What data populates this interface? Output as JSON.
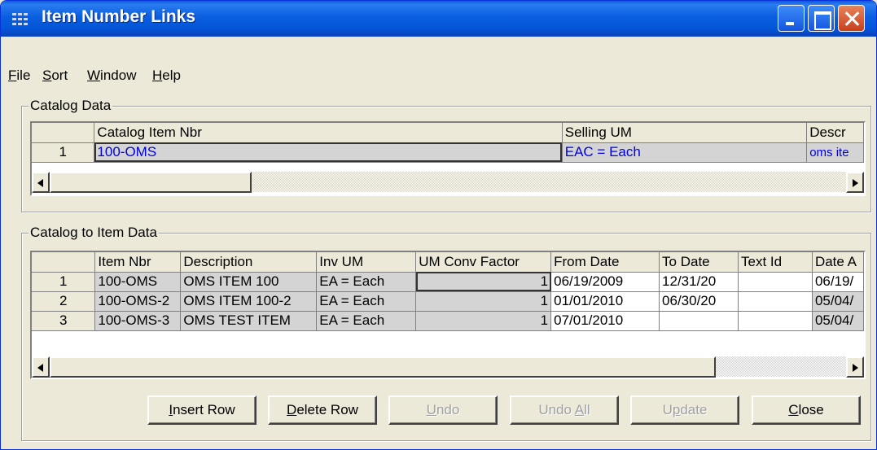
{
  "window": {
    "title": "Item Number Links"
  },
  "menu": [
    {
      "label": "File",
      "accel": "F",
      "rest": "ile"
    },
    {
      "label": "Sort",
      "accel": "S",
      "rest": "ort"
    },
    {
      "label": "Window",
      "accel": "W",
      "rest": "indow"
    },
    {
      "label": "Help",
      "accel": "H",
      "rest": "elp"
    }
  ],
  "catalog": {
    "group_label": "Catalog Data",
    "columns": [
      "Catalog Item Nbr",
      "Selling UM",
      "Descr"
    ],
    "rows": [
      {
        "num": "1",
        "item": "100-OMS",
        "um": "EAC = Each",
        "desc": "oms ite"
      }
    ]
  },
  "item_data": {
    "group_label": "Catalog to Item Data",
    "columns": [
      "Item Nbr",
      "Description",
      "Inv UM",
      "UM Conv Factor",
      "From Date",
      "To Date",
      "Text Id",
      "Date A"
    ],
    "rows": [
      {
        "num": "1",
        "item": "100-OMS",
        "desc": "OMS ITEM 100",
        "um": "EA = Each",
        "factor": "1",
        "from": "06/19/2009",
        "to": "12/31/20",
        "text": "",
        "date": "06/19/"
      },
      {
        "num": "2",
        "item": "100-OMS-2",
        "desc": "OMS ITEM 100-2",
        "um": "EA = Each",
        "factor": "1",
        "from": "01/01/2010",
        "to": "06/30/20",
        "text": "",
        "date": "05/04/"
      },
      {
        "num": "3",
        "item": "100-OMS-3",
        "desc": "OMS TEST ITEM",
        "um": "EA = Each",
        "factor": "1",
        "from": "07/01/2010",
        "to": "",
        "text": "",
        "date": "05/04/"
      }
    ]
  },
  "buttons": {
    "insert": {
      "accel": "I",
      "rest": "nsert Row"
    },
    "delete": {
      "accel": "D",
      "rest": "elete Row"
    },
    "undo": {
      "accel": "U",
      "rest": "ndo"
    },
    "undo_all": {
      "pre": "Undo ",
      "accel": "A",
      "rest": "ll"
    },
    "update": {
      "pre": "U",
      "accel": "p",
      "rest": "date"
    },
    "close": {
      "accel": "C",
      "rest": "lose"
    }
  }
}
